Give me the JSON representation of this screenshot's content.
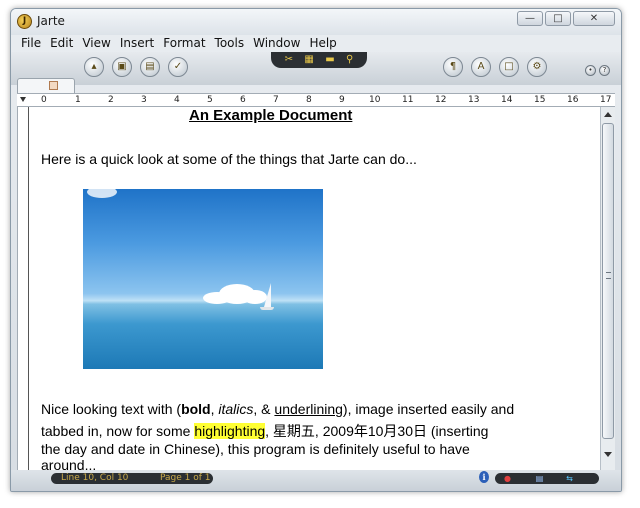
{
  "window": {
    "title": "Jarte",
    "minimize": "—",
    "maximize": "□",
    "close": "✕"
  },
  "menu": [
    "File",
    "Edit",
    "View",
    "Insert",
    "Format",
    "Tools",
    "Window",
    "Help"
  ],
  "toolbar": {
    "left_icons": [
      "open-file-icon",
      "save-icon",
      "print-icon",
      "spell-check-icon"
    ],
    "center_icons": [
      "cut-copy-paste-icon",
      "picture-icon",
      "folder-icon",
      "find-icon"
    ],
    "right_icons": [
      "paragraph-icon",
      "font-icon",
      "insert-icon",
      "settings-icon"
    ],
    "small_icons": [
      "pin-icon",
      "help-icon"
    ]
  },
  "ruler": [
    "0",
    "1",
    "2",
    "3",
    "4",
    "5",
    "6",
    "7",
    "8",
    "9",
    "10",
    "11",
    "12",
    "13",
    "14",
    "15",
    "16",
    "17"
  ],
  "document": {
    "title": "An Example Document",
    "intro": "Here is a quick look at some of the things that Jarte can do...",
    "para_a": "Nice looking text with (",
    "bold": "bold",
    "sep1": ", ",
    "italics": "italics",
    "sep2": ", & ",
    "underlining": "underlining",
    "para_b": "), image inserted easily and",
    "para_c": "tabbed in, now for some ",
    "highlighting": "highlighting",
    "para_d": ", 星期五, 2009年10月30日 (inserting",
    "para_e": "the day and date in Chinese), this program is definitely useful to have",
    "para_f": "around..."
  },
  "status": {
    "position": "Line 10, Col 10",
    "page": "Page 1 of 1"
  }
}
